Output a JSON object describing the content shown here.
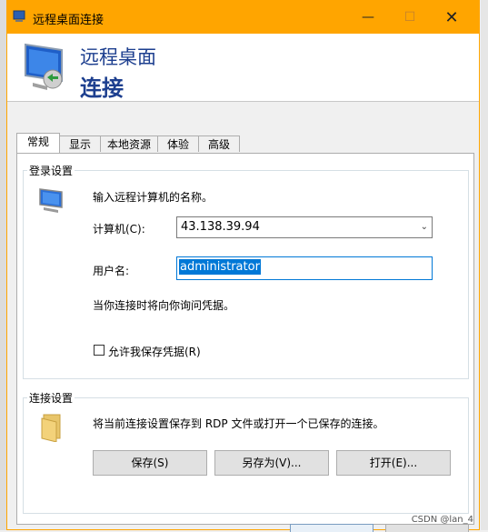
{
  "window": {
    "title": "远程桌面连接"
  },
  "header": {
    "title_line1": "远程桌面",
    "title_line2": "连接"
  },
  "tabs": [
    {
      "label": "常规"
    },
    {
      "label": "显示"
    },
    {
      "label": "本地资源"
    },
    {
      "label": "体验"
    },
    {
      "label": "高级"
    }
  ],
  "login": {
    "group_label": "登录设置",
    "prompt": "输入远程计算机的名称。",
    "computer_label": "计算机(C):",
    "computer_value": "43.138.39.94",
    "user_label": "用户名:",
    "user_value": "administrator",
    "hint": "当你连接时将向你询问凭据。",
    "save_checkbox_label": "允许我保存凭据(R)",
    "save_checkbox_checked": false
  },
  "connection": {
    "group_label": "连接设置",
    "description": "将当前连接设置保存到 RDP 文件或打开一个已保存的连接。",
    "save_button": "保存(S)",
    "save_as_button": "另存为(V)...",
    "open_button": "打开(E)..."
  },
  "watermark": "CSDN @lan_4",
  "colors": {
    "titlebar": "#ffa500",
    "header_text": "#1d3f8f",
    "focus_border": "#0078d7"
  }
}
